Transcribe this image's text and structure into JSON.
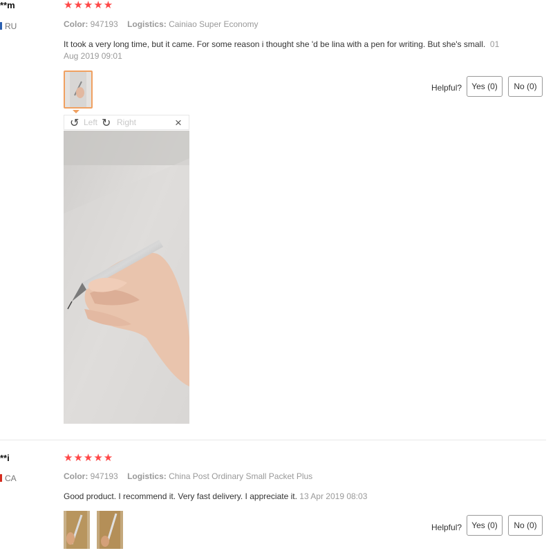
{
  "reviews": [
    {
      "user": "**m",
      "country": "RU",
      "stars": "★★★★★",
      "color_label": "Color:",
      "color_value": "947193",
      "logistics_label": "Logistics:",
      "logistics_value": "Cainiao Super Economy",
      "text": "It took a very long time, but it came. For some reason i thought she 'd be lina with a pen for writing. But she's small.",
      "date_part1": "01",
      "date_part2": "Aug 2019 09:01",
      "helpful_label": "Helpful?",
      "yes_label": "Yes (0)",
      "no_label": "No (0)"
    },
    {
      "user": "**i",
      "country": "CA",
      "stars": "★★★★★",
      "color_label": "Color:",
      "color_value": "947193",
      "logistics_label": "Logistics:",
      "logistics_value": "China Post Ordinary Small Packet Plus",
      "text": "Good product. I recommend it. Very fast delivery. I appreciate it.",
      "date": "13 Apr 2019 08:03",
      "helpful_label": "Helpful?",
      "yes_label": "Yes (0)",
      "no_label": "No (0)"
    }
  ],
  "viewer": {
    "rotate_left_label": "Left",
    "rotate_right_label": "Right",
    "close_glyph": "×",
    "rotate_left_glyph": "↺",
    "rotate_right_glyph": "↻",
    "rotate_left_icon": "rotate-left-icon",
    "rotate_right_icon": "rotate-right-icon",
    "close_icon": "close-icon"
  },
  "colors": {
    "star": "#ff4747",
    "selected_thumb_border": "#f0a060"
  }
}
